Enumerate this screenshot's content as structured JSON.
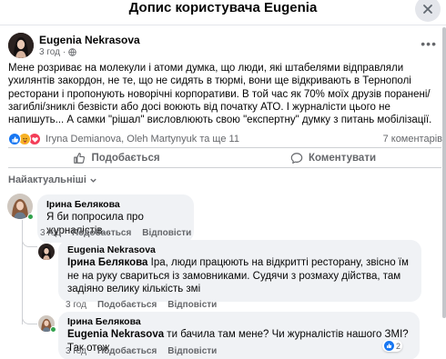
{
  "header": {
    "title": "Допис користувача Eugenia"
  },
  "post": {
    "author": "Eugenia Nekrasova",
    "time": "3 год",
    "body": "Мене розриває на молекули і атоми думка, що люди, які штабелями відправляли ухилянтів закордон, не те, що не сидять в тюрмі, вони ще відкривають в Тернополі ресторани і пропонують новорічні корпоративи. В той час як 70% моїх друзів поранені/загиблі/зниклі безвісти або досі воюють від початку АТО. І журналісти цього не напишуть... А самки \"рішал\" висловлюють свою \"експертну\" думку з питань мобілізації.",
    "reactions_text": "Iryna Demianova, Oleh Martynyuk та ще 11",
    "comments_count": "7 коментарів"
  },
  "actions": {
    "like": "Подобається",
    "comment": "Коментувати"
  },
  "sort_label": "Найактуальніші",
  "comments": [
    {
      "author": "Ірина Белякова",
      "text": "Я би попросила про журналістів...",
      "time": "3 год",
      "like": "Подобається",
      "reply": "Відповісти"
    },
    {
      "author": "Eugenia Nekrasova",
      "mention": "Ірина Белякова",
      "text": " Іра, люди працюють на відкритті ресторану, звісно їм не на руку свариться із замовниками. Судячи з розмаху дійства, там задіяно велику кількість змі",
      "time": "3 год",
      "like": "Подобається",
      "reply": "Відповісти"
    },
    {
      "author": "Ірина Белякова",
      "mention": "Eugenia Nekrasova",
      "text": " ти бачила там мене? Чи журналістів нашого ЗМІ? Так отож",
      "time": "3 год",
      "like": "Подобається",
      "reply": "Відповісти",
      "reaction_count": "2"
    }
  ],
  "colors": {
    "accent": "#1877f2",
    "muted": "#65676b",
    "bubble": "#f0f2f5",
    "online": "#31a24c"
  }
}
